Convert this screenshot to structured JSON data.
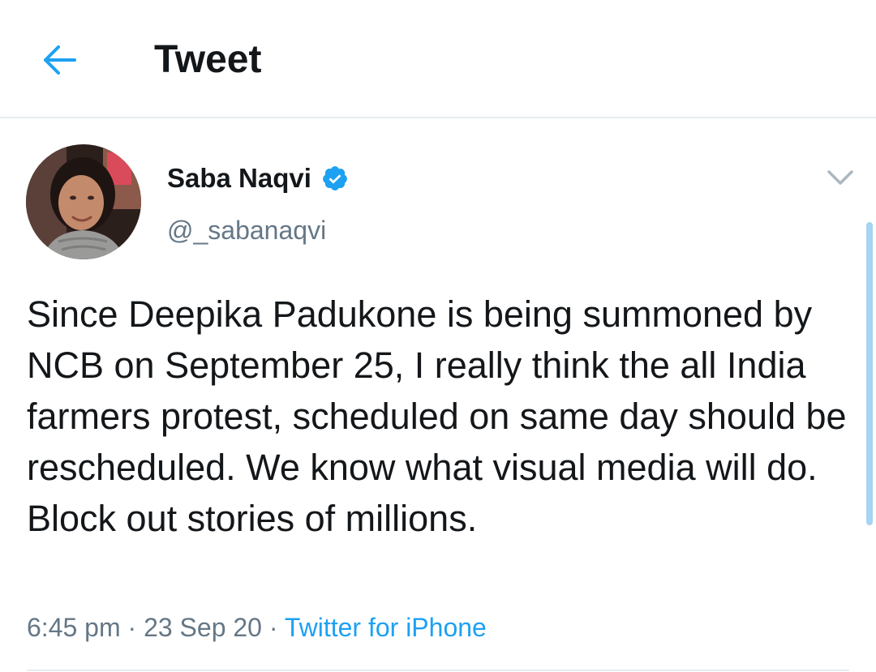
{
  "header": {
    "back_icon": "arrow-left-icon",
    "title": "Tweet"
  },
  "tweet": {
    "author": {
      "display_name": "Saba Naqvi",
      "handle": "@_sabanaqvi",
      "verified": true,
      "verified_icon": "verified-badge-icon"
    },
    "menu_icon": "chevron-down-icon",
    "text": "Since Deepika Padukone is being summoned by NCB on September 25, I really think the all India farmers protest, scheduled on same day should be rescheduled. We know what visual media will do. Block out stories of millions.",
    "time": "6:45 pm",
    "separator": "·",
    "date": "23 Sep 20",
    "source": "Twitter for iPhone"
  },
  "colors": {
    "accent": "#1da1f2",
    "text": "#14171a",
    "secondary_text": "#657786",
    "divider": "#e6ecf0",
    "scroll_indicator": "#a6d4f2"
  }
}
